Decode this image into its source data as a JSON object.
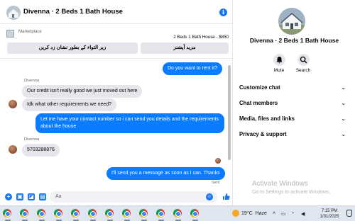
{
  "chat": {
    "title": "Divenna · 2 Beds 1 Bath House",
    "marketplace_label": "Marketplace",
    "listing": "2 Beds 1 Bath House - $850",
    "quick_reply_1": "زیر التواء کے بطور نشان زد کریں",
    "quick_reply_2": "مزید آپشنز",
    "messages": [
      {
        "dir": "out",
        "text": "Do you want to rent it?"
      },
      {
        "dir": "in",
        "sender": "Divenna",
        "text": "Our credit isn't really good we just moved out here"
      },
      {
        "dir": "in",
        "text": "Idk what other requirements we need?"
      },
      {
        "dir": "out",
        "text": "Let me have your contact number so i can send you details and the requirements about the house"
      },
      {
        "dir": "in",
        "sender": "Divenna",
        "text": "5703288876"
      },
      {
        "dir": "out",
        "text": "I'll send you a message as soon as I can. Thanks"
      }
    ],
    "status": "Sent",
    "composer_placeholder": "Aa"
  },
  "info": {
    "name": "Divenna · 2 Beds 1 Bath House",
    "mute_label": "Mute",
    "search_label": "Search",
    "sections": [
      "Customize chat",
      "Chat members",
      "Media, files and links",
      "Privacy & support"
    ]
  },
  "watermark": {
    "title": "Activate Windows",
    "subtitle": "Go to Settings to activate Windows."
  },
  "taskbar": {
    "temperature": "19°C",
    "condition": "Haze",
    "time": "7:15 PM",
    "date": "1/31/2025"
  },
  "icons": {
    "info": "info-icon",
    "plus": "plus-icon",
    "photo": "photo-icon",
    "sticker": "sticker-icon",
    "gif": "gif-icon",
    "emoji": "emoji-icon",
    "like": "thumbs-up-icon",
    "mute": "bell-icon",
    "search": "search-icon",
    "chevron": "chevron-down-icon",
    "browser": "chrome-icon"
  },
  "colors": {
    "accent": "#0a7cff",
    "incoming_bubble": "#e4e6eb"
  }
}
